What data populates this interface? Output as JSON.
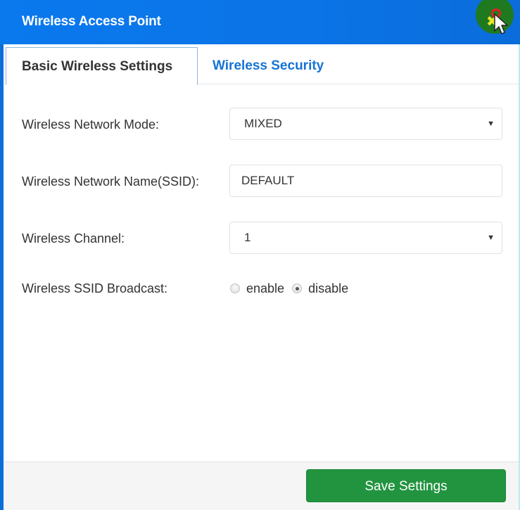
{
  "window": {
    "title": "Wireless Access Point",
    "close_icon": "close-x-icon"
  },
  "tabs": [
    {
      "label": "Basic Wireless Settings",
      "active": true
    },
    {
      "label": "Wireless Security",
      "active": false
    }
  ],
  "form": {
    "network_mode": {
      "label": "Wireless Network Mode:",
      "value": "MIXED"
    },
    "ssid": {
      "label": "Wireless Network Name(SSID):",
      "value": "DEFAULT"
    },
    "channel": {
      "label": "Wireless Channel:",
      "value": "1"
    },
    "ssid_broadcast": {
      "label": "Wireless SSID Broadcast:",
      "options": [
        {
          "label": "enable",
          "checked": false
        },
        {
          "label": "disable",
          "checked": true
        }
      ]
    }
  },
  "footer": {
    "save_label": "Save Settings"
  },
  "colors": {
    "titlebar": "#0b74e6",
    "tab_active_text": "#333333",
    "tab_inactive_text": "#1673d4",
    "save_button": "#22943f"
  }
}
